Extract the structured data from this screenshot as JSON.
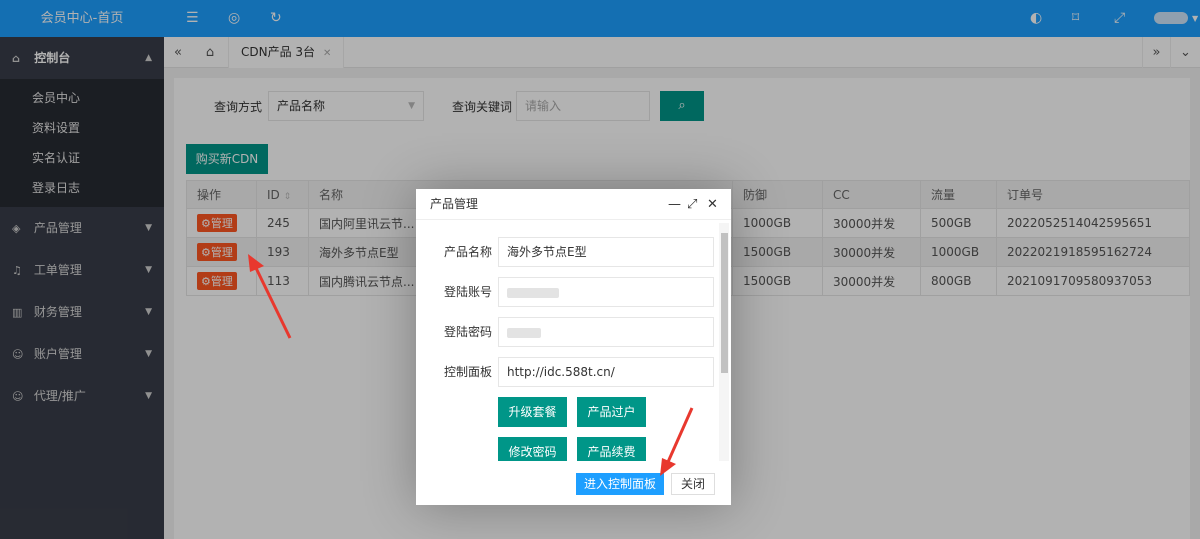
{
  "logo": "会员中心-首页",
  "sidebar": {
    "items": [
      {
        "label": "控制台",
        "icon": "home-icon",
        "expanded": true,
        "children": [
          "会员中心",
          "资料设置",
          "实名认证",
          "登录日志"
        ]
      },
      {
        "label": "产品管理",
        "icon": "cube-icon"
      },
      {
        "label": "工单管理",
        "icon": "bell-icon"
      },
      {
        "label": "财务管理",
        "icon": "chart-icon"
      },
      {
        "label": "账户管理",
        "icon": "user-icon"
      },
      {
        "label": "代理/推广",
        "icon": "user-icon"
      }
    ]
  },
  "topbar": {
    "icons": [
      "menu-fold-icon",
      "globe-icon",
      "refresh-icon",
      "theme-icon",
      "tag-icon",
      "fullscreen-icon"
    ]
  },
  "tabs": {
    "active_label": "CDN产品 3台"
  },
  "search": {
    "method_label": "查询方式",
    "method_value": "产品名称",
    "keyword_label": "查询关键词",
    "keyword_placeholder": "请输入"
  },
  "buy_button": "购买新CDN",
  "table": {
    "headers": [
      "操作",
      "ID",
      "名称",
      "防御",
      "CC",
      "流量",
      "订单号"
    ],
    "manage_label": "管理",
    "rows": [
      {
        "id": "245",
        "name": "国内阿里讯云节...",
        "defense": "1000GB",
        "cc": "30000并发",
        "traffic": "500GB",
        "order": "2022052514042595651"
      },
      {
        "id": "193",
        "name": "海外多节点E型",
        "defense": "1500GB",
        "cc": "30000并发",
        "traffic": "1000GB",
        "order": "2022021918595162724"
      },
      {
        "id": "113",
        "name": "国内腾讯云节点...",
        "defense": "1500GB",
        "cc": "30000并发",
        "traffic": "800GB",
        "order": "2021091709580937053"
      }
    ]
  },
  "modal": {
    "title": "产品管理",
    "fields": [
      {
        "label": "产品名称",
        "value": "海外多节点E型"
      },
      {
        "label": "登陆账号",
        "value": ""
      },
      {
        "label": "登陆密码",
        "value": ""
      },
      {
        "label": "控制面板",
        "value": "http://idc.588t.cn/"
      }
    ],
    "buttons": [
      "升级套餐",
      "产品过户",
      "修改密码",
      "产品续费"
    ],
    "enter_button": "进入控制面板",
    "close_button": "关闭"
  },
  "colors": {
    "primary": "#1e9fff",
    "green": "#009688",
    "orange": "#ff5722",
    "sidebar": "#393d49",
    "arrow": "#e8382e"
  }
}
